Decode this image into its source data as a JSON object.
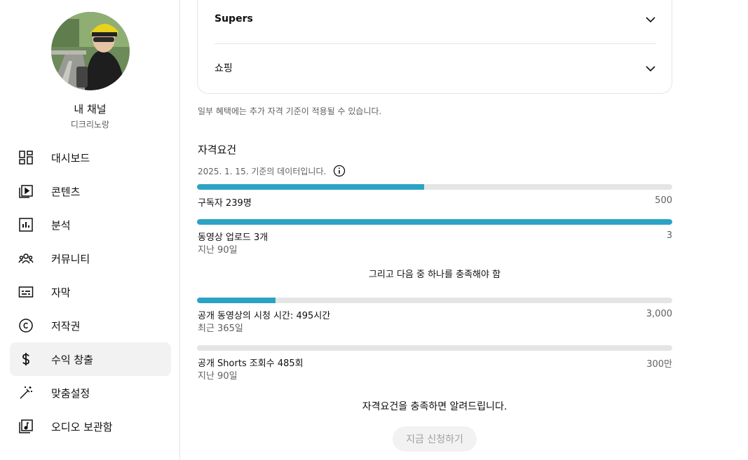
{
  "channel": {
    "title": "내 채널",
    "handle": "디크리노랑"
  },
  "sidebar": {
    "items": [
      {
        "label": "대시보드",
        "icon": "dashboard-icon"
      },
      {
        "label": "콘텐츠",
        "icon": "content-icon"
      },
      {
        "label": "분석",
        "icon": "analytics-icon"
      },
      {
        "label": "커뮤니티",
        "icon": "community-icon"
      },
      {
        "label": "자막",
        "icon": "subtitles-icon"
      },
      {
        "label": "저작권",
        "icon": "copyright-icon"
      },
      {
        "label": "수익 창출",
        "icon": "dollar-icon",
        "active": true
      },
      {
        "label": "맞춤설정",
        "icon": "magic-wand-icon"
      },
      {
        "label": "오디오 보관함",
        "icon": "audio-library-icon"
      }
    ]
  },
  "benefits": {
    "items": [
      {
        "title": "Supers"
      },
      {
        "title": "쇼핑"
      }
    ],
    "note": "일부 혜택에는 추가 자격 기준이 적용될 수 있습니다."
  },
  "eligibility": {
    "title": "자격요건",
    "data_date": "2025. 1. 15. 기준의 데이터입니다.",
    "requirements": [
      {
        "label": "구독자 239명",
        "sub": "",
        "target": "500",
        "progress": 0.478
      },
      {
        "label": "동영상 업로드 3개",
        "sub": "지난 90일",
        "target": "3",
        "progress": 1.0
      }
    ],
    "and_text": "그리고 다음 중 하나를 충족해야 함",
    "options": [
      {
        "label": "공개 동영상의 시청 시간: 495시간",
        "sub": "최근 365일",
        "target": "3,000",
        "progress": 0.165
      },
      {
        "label": "공개 Shorts 조회수 485회",
        "sub": "지난 90일",
        "target": "300만",
        "progress": 0.0
      }
    ],
    "notify_text": "자격요건을 충족하면 알려드립니다.",
    "apply_label": "지금 신청하기"
  },
  "colors": {
    "progress": "#2ba3c6",
    "track": "#e5e5e5",
    "active_nav": "#f2f2f2"
  }
}
